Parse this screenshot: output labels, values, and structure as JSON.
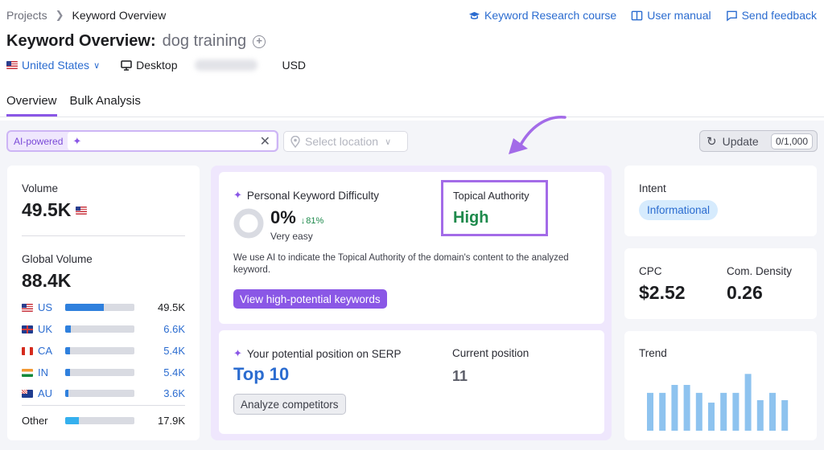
{
  "breadcrumb": {
    "root": "Projects",
    "current": "Keyword Overview"
  },
  "links": {
    "course": "Keyword Research course",
    "manual": "User manual",
    "feedback": "Send feedback"
  },
  "title": {
    "prefix": "Keyword Overview:",
    "keyword": "dog training"
  },
  "meta": {
    "country": "United States",
    "device": "Desktop",
    "currency": "USD"
  },
  "tabs": [
    {
      "label": "Overview"
    },
    {
      "label": "Bulk Analysis"
    }
  ],
  "filters": {
    "ai_label": "AI-powered",
    "location_placeholder": "Select location",
    "update_label": "Update",
    "update_count": "0/1,000"
  },
  "volume": {
    "label": "Volume",
    "value": "49.5K"
  },
  "global_volume": {
    "label": "Global Volume",
    "value": "88.4K",
    "rows": [
      {
        "code": "US",
        "value": "49.5K",
        "fraction": 0.56
      },
      {
        "code": "UK",
        "value": "6.6K",
        "fraction": 0.08
      },
      {
        "code": "CA",
        "value": "5.4K",
        "fraction": 0.07
      },
      {
        "code": "IN",
        "value": "5.4K",
        "fraction": 0.07
      },
      {
        "code": "AU",
        "value": "3.6K",
        "fraction": 0.05
      }
    ],
    "other": {
      "label": "Other",
      "value": "17.9K",
      "fraction": 0.2
    }
  },
  "pkd": {
    "label": "Personal Keyword Difficulty",
    "value": "0%",
    "change": "81%",
    "rating": "Very easy",
    "description": "We use AI to indicate the Topical Authority of the domain's content to the analyzed keyword.",
    "button": "View high-potential keywords"
  },
  "topical_authority": {
    "label": "Topical Authority",
    "value": "High"
  },
  "serp": {
    "label": "Your potential position on SERP",
    "value": "Top 10",
    "current_label": "Current position",
    "current_value": "11",
    "button": "Analyze competitors"
  },
  "intent": {
    "label": "Intent",
    "value": "Informational"
  },
  "cpc": {
    "label": "CPC",
    "value": "$2.52"
  },
  "density": {
    "label": "Com. Density",
    "value": "0.26"
  },
  "trend": {
    "label": "Trend",
    "values": [
      0.62,
      0.62,
      0.75,
      0.75,
      0.62,
      0.46,
      0.62,
      0.62,
      0.93,
      0.5,
      0.62,
      0.5
    ]
  },
  "colors": {
    "accent": "#8a57e6",
    "link": "#2b6cd0",
    "high": "#1e8a4c",
    "bar": "#2f80dd",
    "trend_bar": "#8ec3ef"
  }
}
